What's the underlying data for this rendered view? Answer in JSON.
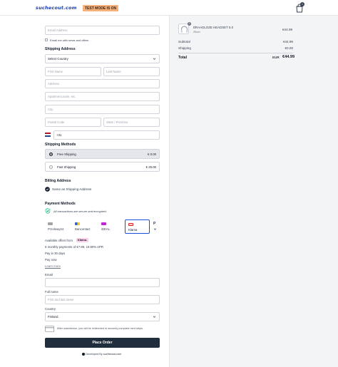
{
  "header": {
    "logo": "suchecout.com",
    "test_badge": "TEST MODE IS ON",
    "cart_count": "1"
  },
  "contact": {
    "email_placeholder": "Email Address",
    "newsletter_label": "Email me with news and offers"
  },
  "shipping_address": {
    "title": "Shipping Address",
    "country_placeholder": "Select Country",
    "first_name_placeholder": "First Name",
    "last_name_placeholder": "Last Name",
    "address_placeholder": "Address",
    "apartment_placeholder": "Apartment,suite, etc.",
    "city_placeholder": "City",
    "postal_placeholder": "Postal Code",
    "state_placeholder": "State / Province",
    "phone_value": "+31"
  },
  "shipping_methods": {
    "title": "Shipping Methods",
    "options": [
      {
        "name": "Free Shipping",
        "price": "€ 0.00",
        "selected": true
      },
      {
        "name": "Fast Shipping",
        "price": "€ 25.00",
        "selected": false
      }
    ]
  },
  "billing": {
    "title": "Billing Address",
    "same_as_shipping_label": "Same as Shipping Address"
  },
  "payment": {
    "title": "Payment Methods",
    "secure_note": "All transactions are secure and encrypted.",
    "methods": [
      {
        "label": "Przelewy24",
        "color": "#a3a3a3"
      },
      {
        "label": "Bancontact",
        "color": "#2563eb"
      },
      {
        "label": "iDEAL",
        "color": "#c026d3"
      },
      {
        "label": "Klarna",
        "color": "#dc2626"
      }
    ],
    "available_offers_label": "Available offers from",
    "klarna_badge": "Klarna.",
    "offers": [
      "6 monthly payments of €7.89, 19.90% APR",
      "Pay in 30 days",
      "Pay now"
    ],
    "learn_more": "Learn more",
    "email_label": "Email",
    "full_name_label": "Full name",
    "full_name_placeholder": "First and last name",
    "country_label": "Country",
    "country_value": "Finland",
    "redirect_note": "After submission, you will be redirected to securely complete next steps."
  },
  "place_order_label": "Place Order",
  "footer": {
    "developed_by": "Developed By",
    "brand": "suchecout.com"
  },
  "order": {
    "product_name": "DRAADLOZE HEADSET 5.0",
    "product_variant": "Zilver",
    "product_qty": "1",
    "product_price": "€44.99",
    "subtotal_label": "Subtotal",
    "subtotal_value": "€44.99",
    "shipping_label": "Shipping",
    "shipping_value": "€0.00",
    "total_label": "Total",
    "total_currency": "EUR",
    "total_value": "€44.99"
  },
  "colors": {
    "place_button": "#1f2d3d",
    "test_badge": "#f4b27a",
    "selected_payment_border": "#1d4ed8",
    "logo": "#1e40af"
  },
  "icons": [
    "cart-icon",
    "shield-check-icon",
    "check-circle-icon",
    "chevron-down-icon",
    "netherlands-flag-icon",
    "card-icon",
    "info-icon",
    "paypal-icon"
  ]
}
